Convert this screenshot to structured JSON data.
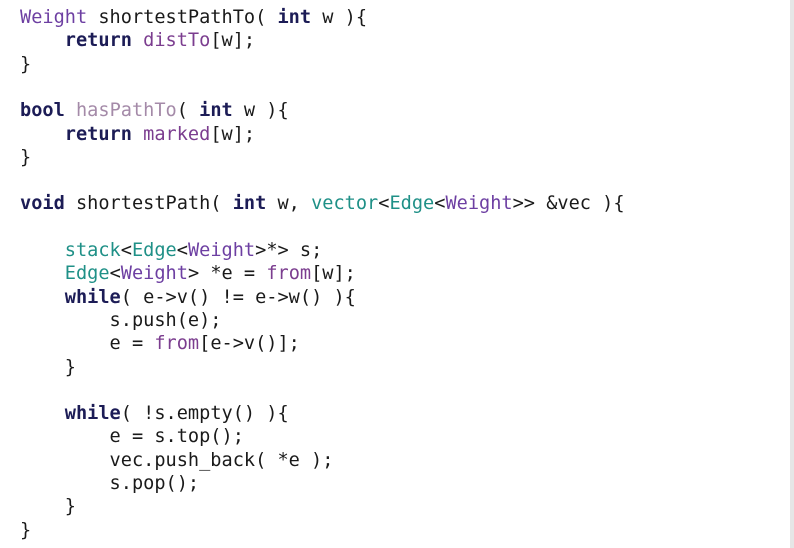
{
  "editor": {
    "lines": [
      [
        {
          "t": "Weight",
          "c": "type"
        },
        {
          "t": " shortestPathTo( ",
          "c": "ident"
        },
        {
          "t": "int",
          "c": "kw"
        },
        {
          "t": " w ){",
          "c": "ident"
        }
      ],
      [
        {
          "t": "    ",
          "c": "ident"
        },
        {
          "t": "return",
          "c": "kw"
        },
        {
          "t": " ",
          "c": "ident"
        },
        {
          "t": "distTo",
          "c": "field"
        },
        {
          "t": "[w];",
          "c": "ident"
        }
      ],
      [
        {
          "t": "}",
          "c": "ident"
        }
      ],
      [],
      [
        {
          "t": "bool",
          "c": "kw"
        },
        {
          "t": " ",
          "c": "ident"
        },
        {
          "t": "hasPathTo",
          "c": "grey"
        },
        {
          "t": "( ",
          "c": "ident"
        },
        {
          "t": "int",
          "c": "kw"
        },
        {
          "t": " w ){",
          "c": "ident"
        }
      ],
      [
        {
          "t": "    ",
          "c": "ident"
        },
        {
          "t": "return",
          "c": "kw"
        },
        {
          "t": " ",
          "c": "ident"
        },
        {
          "t": "marked",
          "c": "field"
        },
        {
          "t": "[w];",
          "c": "ident"
        }
      ],
      [
        {
          "t": "}",
          "c": "ident"
        }
      ],
      [],
      [
        {
          "t": "void",
          "c": "kw"
        },
        {
          "t": " shortestPath( ",
          "c": "ident"
        },
        {
          "t": "int",
          "c": "kw"
        },
        {
          "t": " w, ",
          "c": "ident"
        },
        {
          "t": "vector",
          "c": "teal"
        },
        {
          "t": "<",
          "c": "ident"
        },
        {
          "t": "Edge",
          "c": "teal"
        },
        {
          "t": "<",
          "c": "ident"
        },
        {
          "t": "Weight",
          "c": "type"
        },
        {
          "t": ">> &vec ){",
          "c": "ident"
        }
      ],
      [],
      [
        {
          "t": "    ",
          "c": "ident"
        },
        {
          "t": "stack",
          "c": "teal"
        },
        {
          "t": "<",
          "c": "ident"
        },
        {
          "t": "Edge",
          "c": "teal"
        },
        {
          "t": "<",
          "c": "ident"
        },
        {
          "t": "Weight",
          "c": "type"
        },
        {
          "t": ">*> s;",
          "c": "ident"
        }
      ],
      [
        {
          "t": "    ",
          "c": "ident"
        },
        {
          "t": "Edge",
          "c": "teal"
        },
        {
          "t": "<",
          "c": "ident"
        },
        {
          "t": "Weight",
          "c": "type"
        },
        {
          "t": "> *e = ",
          "c": "ident"
        },
        {
          "t": "from",
          "c": "field"
        },
        {
          "t": "[w];",
          "c": "ident"
        }
      ],
      [
        {
          "t": "    ",
          "c": "ident"
        },
        {
          "t": "while",
          "c": "kw"
        },
        {
          "t": "( e->v() != e->w() ){",
          "c": "ident"
        }
      ],
      [
        {
          "t": "        s.push(e);",
          "c": "ident"
        }
      ],
      [
        {
          "t": "        e = ",
          "c": "ident"
        },
        {
          "t": "from",
          "c": "field"
        },
        {
          "t": "[e->v()];",
          "c": "ident"
        }
      ],
      [
        {
          "t": "    }",
          "c": "ident"
        }
      ],
      [],
      [
        {
          "t": "    ",
          "c": "ident"
        },
        {
          "t": "while",
          "c": "kw"
        },
        {
          "t": "( !s.empty() ){",
          "c": "ident"
        }
      ],
      [
        {
          "t": "        e = s.top();",
          "c": "ident"
        }
      ],
      [
        {
          "t": "        vec.push_back( *e );",
          "c": "ident"
        }
      ],
      [
        {
          "t": "        s.pop();",
          "c": "ident"
        }
      ],
      [
        {
          "t": "    }",
          "c": "ident"
        }
      ],
      [
        {
          "t": "}",
          "c": "ident"
        }
      ]
    ]
  }
}
